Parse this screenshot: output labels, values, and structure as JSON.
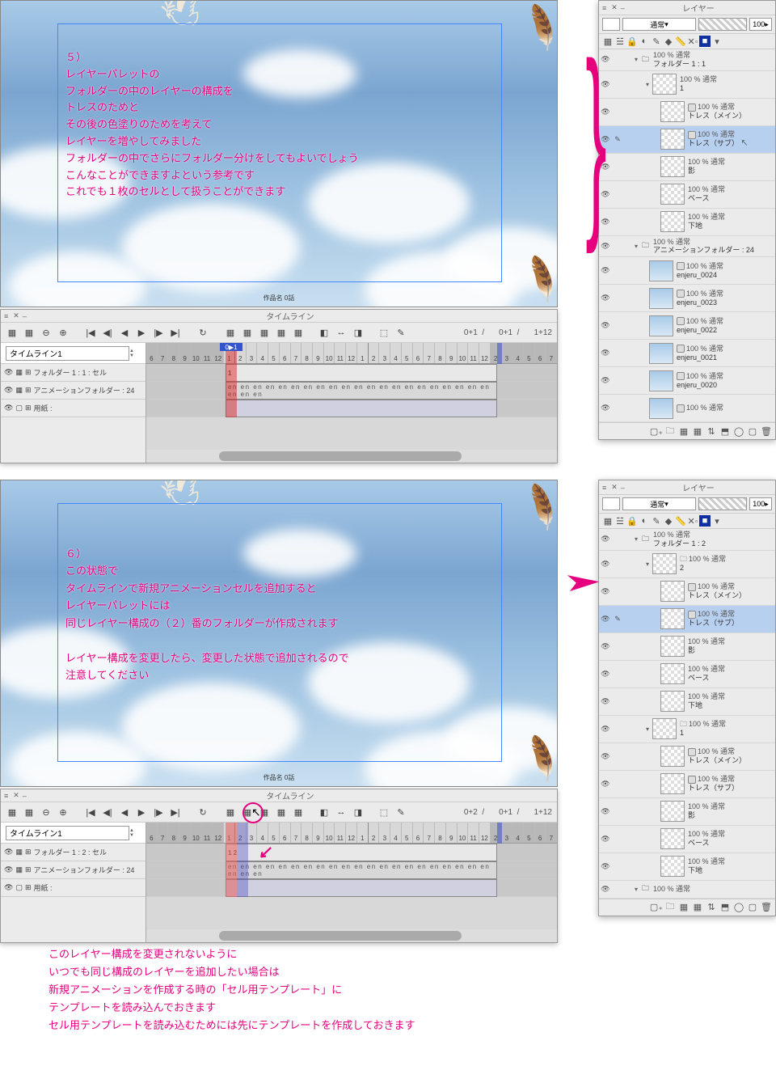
{
  "panel1": {
    "annotation": "５）\nレイヤーパレットの\nフォルダーの中のレイヤーの構成を\nトレスのためと\nその後の色塗りのためを考えて\nレイヤーを増やしてみました\nフォルダーの中でさらにフォルダー分けをしてもよいでしょう\nこんなことができますよという参考です\nこれでも１枚のセルとして扱うことができます",
    "canvas_label": "作品名 0話",
    "layer_panel": {
      "title": "レイヤー",
      "blend": "通常",
      "opacity": "100",
      "folders": [
        {
          "mode": "100 % 通常",
          "name": "フォルダー 1 : 1",
          "type": "folder",
          "open": true
        },
        {
          "mode": "100 % 通常",
          "name": "1",
          "type": "subfolder",
          "open": true
        },
        {
          "mode": "100 % 通常",
          "name": "トレス（メイン）",
          "type": "layer",
          "icon": true
        },
        {
          "mode": "100 % 通常",
          "name": "トレス（サブ）",
          "type": "layer",
          "icon": true,
          "selected": true,
          "cursor": true
        },
        {
          "mode": "100 % 通常",
          "name": "影",
          "type": "layer"
        },
        {
          "mode": "100 % 通常",
          "name": "ベース",
          "type": "layer"
        },
        {
          "mode": "100 % 通常",
          "name": "下地",
          "type": "layer"
        },
        {
          "mode": "100 % 通常",
          "name": "アニメーションフォルダー : 24",
          "type": "folder",
          "open": true
        },
        {
          "mode": "100 % 通常",
          "name": "enjeru_0024",
          "type": "layer",
          "sky": true,
          "icon": true
        },
        {
          "mode": "100 % 通常",
          "name": "enjeru_0023",
          "type": "layer",
          "sky": true,
          "icon": true
        },
        {
          "mode": "100 % 通常",
          "name": "enjeru_0022",
          "type": "layer",
          "sky": true,
          "icon": true
        },
        {
          "mode": "100 % 通常",
          "name": "enjeru_0021",
          "type": "layer",
          "sky": true,
          "icon": true
        },
        {
          "mode": "100 % 通常",
          "name": "enjeru_0020",
          "type": "layer",
          "sky": true,
          "icon": true
        },
        {
          "mode": "100 % 通常",
          "name": "",
          "type": "layer",
          "sky": true,
          "icon": true,
          "partial": true
        }
      ]
    },
    "timeline": {
      "title": "タイムライン",
      "name": "タイムライン1",
      "info": {
        "a": "0+1",
        "b": "0+1",
        "c": "1+12"
      },
      "playhead_label": "0▶1",
      "tracks": [
        {
          "name": "フォルダー 1 : 1 : セル",
          "clip": "1"
        },
        {
          "name": "アニメーションフォルダー : 24",
          "clip": "en en en en en en en en en en en en en en en en en en en en en en en en"
        },
        {
          "name": "用紙 :",
          "clip": ""
        }
      ],
      "ruler_pre": [
        "6",
        "7",
        "8",
        "9",
        "10",
        "11",
        "12"
      ],
      "ruler_main": [
        "1",
        "2",
        "3",
        "4",
        "5",
        "6",
        "7",
        "8",
        "9",
        "10",
        "11",
        "12",
        "1",
        "2",
        "3",
        "4",
        "5",
        "6",
        "7",
        "8",
        "9",
        "10",
        "11",
        "12"
      ],
      "ruler_post": [
        "2",
        "3",
        "4",
        "5",
        "6",
        "7"
      ]
    }
  },
  "panel2": {
    "annotation": "６）\nこの状態で\nタイムラインで新規アニメーションセルを追加すると\nレイヤーパレットには\n同じレイヤー構成の（２）番のフォルダーが作成されます\n\nレイヤー構成を変更したら、変更した状態で追加されるので\n注意してください",
    "canvas_label": "作品名 0話",
    "layer_panel": {
      "title": "レイヤー",
      "blend": "通常",
      "opacity": "100",
      "folders": [
        {
          "mode": "100 % 通常",
          "name": "フォルダー 1 : 2",
          "type": "folder",
          "open": true
        },
        {
          "mode": "100 % 通常",
          "name": "2",
          "type": "subfolder",
          "open": true,
          "foldericon": true
        },
        {
          "mode": "100 % 通常",
          "name": "トレス（メイン）",
          "type": "layer",
          "icon": true
        },
        {
          "mode": "100 % 通常",
          "name": "トレス（サブ）",
          "type": "layer",
          "icon": true,
          "selected": true
        },
        {
          "mode": "100 % 通常",
          "name": "影",
          "type": "layer"
        },
        {
          "mode": "100 % 通常",
          "name": "ベース",
          "type": "layer"
        },
        {
          "mode": "100 % 通常",
          "name": "下地",
          "type": "layer"
        },
        {
          "mode": "100 % 通常",
          "name": "1",
          "type": "subfolder",
          "open": true,
          "foldericon": true
        },
        {
          "mode": "100 % 通常",
          "name": "トレス（メイン）",
          "type": "layer",
          "icon": true
        },
        {
          "mode": "100 % 通常",
          "name": "トレス（サブ）",
          "type": "layer",
          "icon": true
        },
        {
          "mode": "100 % 通常",
          "name": "影",
          "type": "layer"
        },
        {
          "mode": "100 % 通常",
          "name": "ベース",
          "type": "layer"
        },
        {
          "mode": "100 % 通常",
          "name": "下地",
          "type": "layer"
        },
        {
          "mode": "100 % 通常",
          "name": "",
          "type": "folder",
          "partial": true
        }
      ]
    },
    "timeline": {
      "title": "タイムライン",
      "name": "タイムライン1",
      "info": {
        "a": "0+2",
        "b": "0+1",
        "c": "1+12"
      },
      "tracks": [
        {
          "name": "フォルダー 1 : 2 : セル",
          "clip": "1   2"
        },
        {
          "name": "アニメーションフォルダー : 24",
          "clip": "en en en en en en en en en en en en en en en en en en en en en en en en"
        },
        {
          "name": "用紙 :",
          "clip": ""
        }
      ]
    }
  },
  "footer": "このレイヤー構成を変更されないように\nいつでも同じ構成のレイヤーを追加したい場合は\n新規アニメーションを作成する時の「セル用テンプレート」に\nテンプレートを読み込んでおきます\nセル用テンプレートを読み込むためには先にテンプレートを作成しておきます"
}
